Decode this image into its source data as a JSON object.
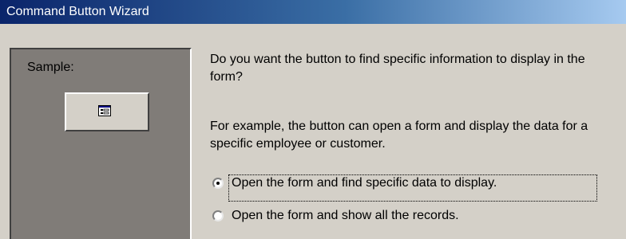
{
  "window": {
    "title": "Command Button Wizard"
  },
  "sample": {
    "label": "Sample:",
    "button_icon": "form-icon"
  },
  "question": {
    "prompt": "Do you want the button to find specific information to display in the form?",
    "example": "For example, the button can open a form and display the data for a specific employee or customer."
  },
  "options": [
    {
      "label": "Open the form and find specific data to display.",
      "selected": true
    },
    {
      "label": "Open the form and show all the records.",
      "selected": false
    }
  ],
  "colors": {
    "titlebar_start": "#0a246a",
    "titlebar_end": "#a6caf0",
    "dialog_bg": "#d4d0c8",
    "sample_pane_bg": "#807c78"
  }
}
